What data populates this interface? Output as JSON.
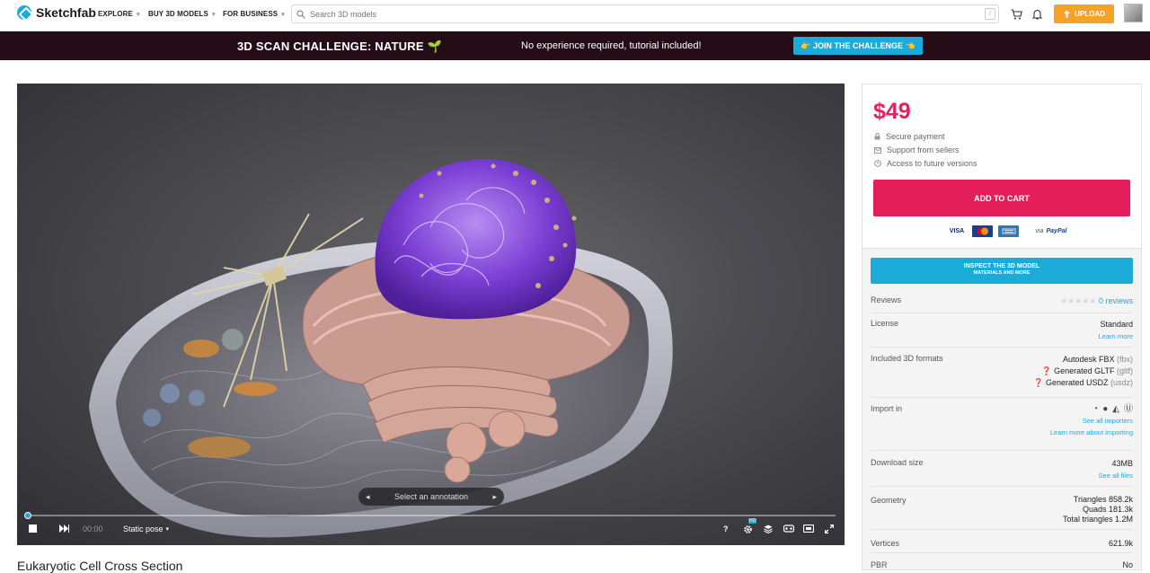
{
  "topnav": {
    "logo_text": "Sketchfab",
    "explore": "EXPLORE",
    "buy": "BUY 3D MODELS",
    "business": "FOR BUSINESS",
    "search_placeholder": "Search 3D models",
    "search_shortcut": "/",
    "upload": "UPLOAD"
  },
  "banner": {
    "title": "3D SCAN CHALLENGE: NATURE 🌱",
    "subtitle": "No experience required, tutorial included!",
    "button": "👉 JOIN THE CHALLENGE 👈"
  },
  "viewer": {
    "annotation": "Select an annotation",
    "time": "00:00",
    "pose": "Static pose",
    "help": "?",
    "hd_badge": "HD"
  },
  "model": {
    "title": "Eukaryotic Cell Cross Section"
  },
  "sidebar": {
    "price": "$49",
    "perks": [
      "Secure payment",
      "Support from sellers",
      "Access to future versions"
    ],
    "add_to_cart": "ADD TO CART",
    "payments": {
      "visa": "VISA",
      "via": "via",
      "paypal": "PayPal"
    },
    "inspect": {
      "line1": "INSPECT THE 3D MODEL",
      "line2": "MATERIALS AND MORE"
    },
    "reviews": {
      "label": "Reviews",
      "value": "0 reviews"
    },
    "license": {
      "label": "License",
      "value": "Standard",
      "link": "Learn more"
    },
    "formats": {
      "label": "Included 3D formats",
      "fbx": "Autodesk FBX",
      "fbx_ext": "(fbx)",
      "gltf": "Generated GLTF",
      "gltf_ext": "(gltf)",
      "usdz": "Generated USDZ",
      "usdz_ext": "(usdz)"
    },
    "import": {
      "label": "Import in",
      "link1": "See all importers",
      "link2": "Learn more about importing"
    },
    "download": {
      "label": "Download size",
      "value": "43MB",
      "link": "See all files"
    },
    "geometry": {
      "label": "Geometry",
      "triangles": "Triangles 858.2k",
      "quads": "Quads 181.3k",
      "total": "Total triangles 1.2M"
    },
    "vertices": {
      "label": "Vertices",
      "value": "621.9k"
    },
    "pbr": {
      "label": "PBR",
      "value": "No"
    }
  }
}
